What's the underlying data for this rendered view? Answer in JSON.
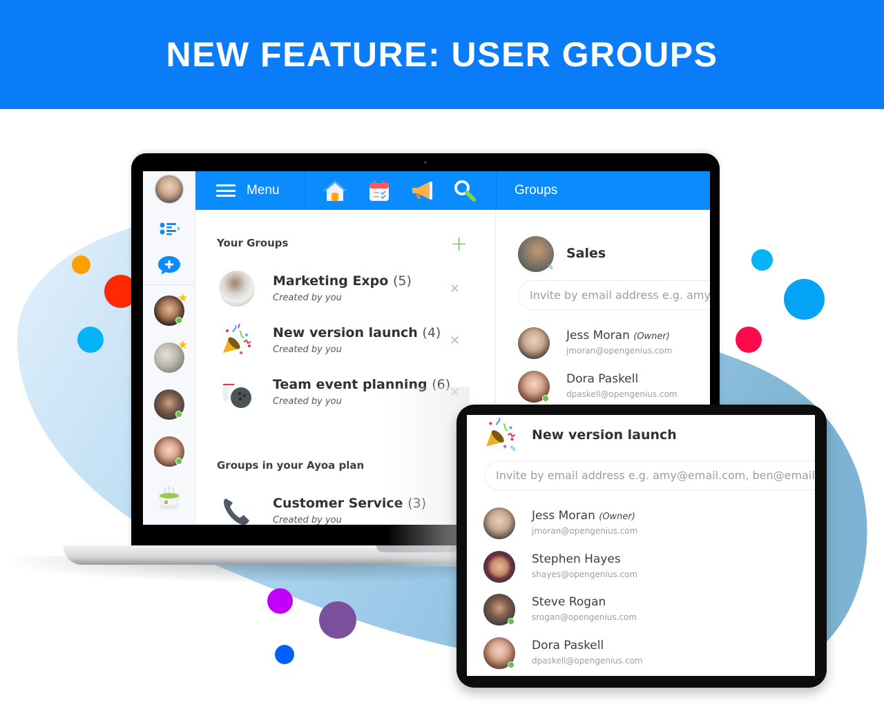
{
  "banner": {
    "title": "NEW FEATURE: USER GROUPS"
  },
  "colors": {
    "brand_blue": "#0a7cf8",
    "topbar_blue": "#0a8cff",
    "online_green": "#5ec44a",
    "add_green": "#5ec44a",
    "star_yellow": "#ffc107",
    "blob_light": "#cfe6f8",
    "blob_dark": "#86bcdc"
  },
  "decor_dots": [
    {
      "color": "#ffa000"
    },
    {
      "color": "#ff2a00"
    },
    {
      "color": "#05b3f7"
    },
    {
      "color": "#05b3f7"
    },
    {
      "color": "#05a3f5"
    },
    {
      "color": "#ff0a4c"
    },
    {
      "color": "#c300f7"
    },
    {
      "color": "#7a4f9b"
    },
    {
      "color": "#0060fb"
    }
  ],
  "laptop": {
    "rail": {
      "items": [
        {
          "icon": "user-avatar",
          "label": "My profile"
        },
        {
          "icon": "task-list-icon",
          "label": "Tasks"
        },
        {
          "icon": "new-chat-icon",
          "label": "New chat"
        },
        {
          "icon": "contact-avatar",
          "starred": true,
          "online": true
        },
        {
          "icon": "group-avatar",
          "starred": true,
          "online": false
        },
        {
          "icon": "contact-avatar",
          "starred": false,
          "online": true
        },
        {
          "icon": "contact-avatar",
          "starred": false,
          "online": true
        },
        {
          "icon": "tea-cup-icon",
          "label": "Break"
        }
      ]
    },
    "topbar": {
      "menu_label": "Menu",
      "icons": [
        "home-icon",
        "calendar-icon",
        "megaphone-icon",
        "search-icon"
      ],
      "panel_title": "Groups"
    },
    "your_groups": {
      "title": "Your Groups",
      "items": [
        {
          "name": "Marketing Expo",
          "count": "(5)",
          "sub": "Created by you",
          "icon": "marketing-photo"
        },
        {
          "name": "New version launch",
          "count": "(4)",
          "sub": "Created by you",
          "icon": "party-popper"
        },
        {
          "name": "Team event planning",
          "count": "(6)",
          "sub": "Created by you",
          "icon": "bowling"
        }
      ]
    },
    "plan_groups": {
      "title": "Groups in your Ayoa plan",
      "items": [
        {
          "name": "Customer Service",
          "count": "(3)",
          "sub": "Created by you",
          "icon": "phone"
        }
      ]
    },
    "detail": {
      "title": "Sales",
      "invite_placeholder": "Invite by email address e.g. amy@email.com, ben@email.com",
      "members": [
        {
          "name": "Jess Moran",
          "role": "(Owner)",
          "email": "jmoran@opengenius.com",
          "online": false
        },
        {
          "name": "Dora Paskell",
          "role": "",
          "email": "dpaskell@opengenius.com",
          "online": true
        }
      ]
    }
  },
  "tablet": {
    "title": "New version launch",
    "invite_placeholder": "Invite by email address e.g. amy@email.com, ben@email.com",
    "members": [
      {
        "name": "Jess Moran",
        "role": "(Owner)",
        "email": "jmoran@opengenius.com",
        "online": false
      },
      {
        "name": "Stephen Hayes",
        "role": "",
        "email": "shayes@opengenius.com",
        "online": false
      },
      {
        "name": "Steve Rogan",
        "role": "",
        "email": "srogan@opengenius.com",
        "online": true
      },
      {
        "name": "Dora Paskell",
        "role": "",
        "email": "dpaskell@opengenius.com",
        "online": true
      }
    ]
  }
}
